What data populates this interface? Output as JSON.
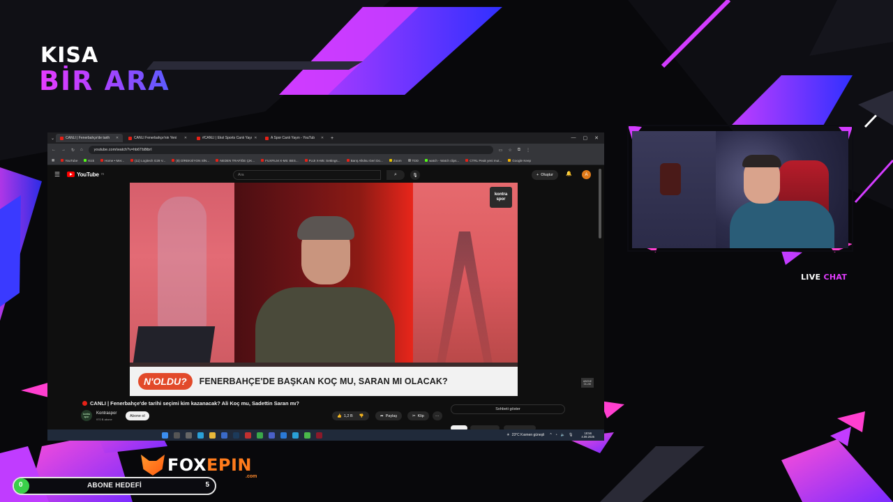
{
  "overlay": {
    "title_line1": "KISA",
    "title_line2": "BİR ARA",
    "live_chat_a": "LIVE",
    "live_chat_b": "CHAT",
    "sponsor_a": "FOX",
    "sponsor_b": "EPIN",
    "sponsor_tld": ".com",
    "goal": {
      "label": "ABONE HEDEFİ",
      "current": "0",
      "target": "5",
      "progress": 0.0
    },
    "accent_colors": {
      "pink": "#e23cff",
      "purple": "#8a2be2",
      "blue": "#3b3bff",
      "orange": "#ff7b1c",
      "green": "#3ad14a"
    }
  },
  "browser": {
    "tabs": [
      {
        "label": "CANLI | Fenerbahçe'de tarih",
        "active": true
      },
      {
        "label": "CANLI Fenerbahçe'nin Yeni",
        "active": false
      },
      {
        "label": "#CANLI | Ekol Sports Canlı Yayı",
        "active": false
      },
      {
        "label": "A Spor Canlı Yayın - YouTub",
        "active": false
      }
    ],
    "new_tab": "+",
    "url": "youtube.com/watch?v=hb6Tb8tbrI",
    "bookmarks": [
      "YouTube",
      "Kick",
      "Home • Mer...",
      "(11) Logitech G29 V...",
      "(8) DİREKSİYON SİN...",
      "NEDEN TRAFİĞE ÇIK...",
      "FUXFILM X-M5: BES...",
      "FUJI X-M5: Settings...",
      "Barış Alkılsu Geri Do...",
      "Zoom",
      "TDD",
      "watch - Watch clips...",
      "CTRL Peak yeni mut...",
      "Google Keep"
    ]
  },
  "youtube": {
    "logo": "YouTube",
    "logo_cc": "TR",
    "search_placeholder": "Ara",
    "create_label": "Oluştur",
    "avatar_letter": "A",
    "video": {
      "channel_badge_line1": "kontra",
      "channel_badge_line2": "spor",
      "lower_third_tag": "N'OLDU?",
      "headline": "FENERBAHÇE'DE BAŞKAN KOÇ MU, SARAN MI OLACAK?",
      "corner_badge_1": "ABONE",
      "corner_badge_2": "OLUN!"
    },
    "title": "CANLI | Fenerbahçe'de tarihi seçimi kim kazanacak? Ali Koç mu, Sadettin Saran mı?",
    "channel": {
      "name": "Kontraspor",
      "subs": "970 B abone",
      "avatar_text_1": "kontra",
      "avatar_text_2": "spor"
    },
    "subscribe_label": "Abone ol",
    "likes": "1,2 B",
    "share_label": "Paylaş",
    "clip_label": "Klip",
    "more_label": "···",
    "chat_show_label": "Sohbeti göster"
  },
  "taskbar": {
    "weather": "23°C Kısmen güneşli",
    "time": "18:56",
    "date": "4.09.2025"
  }
}
